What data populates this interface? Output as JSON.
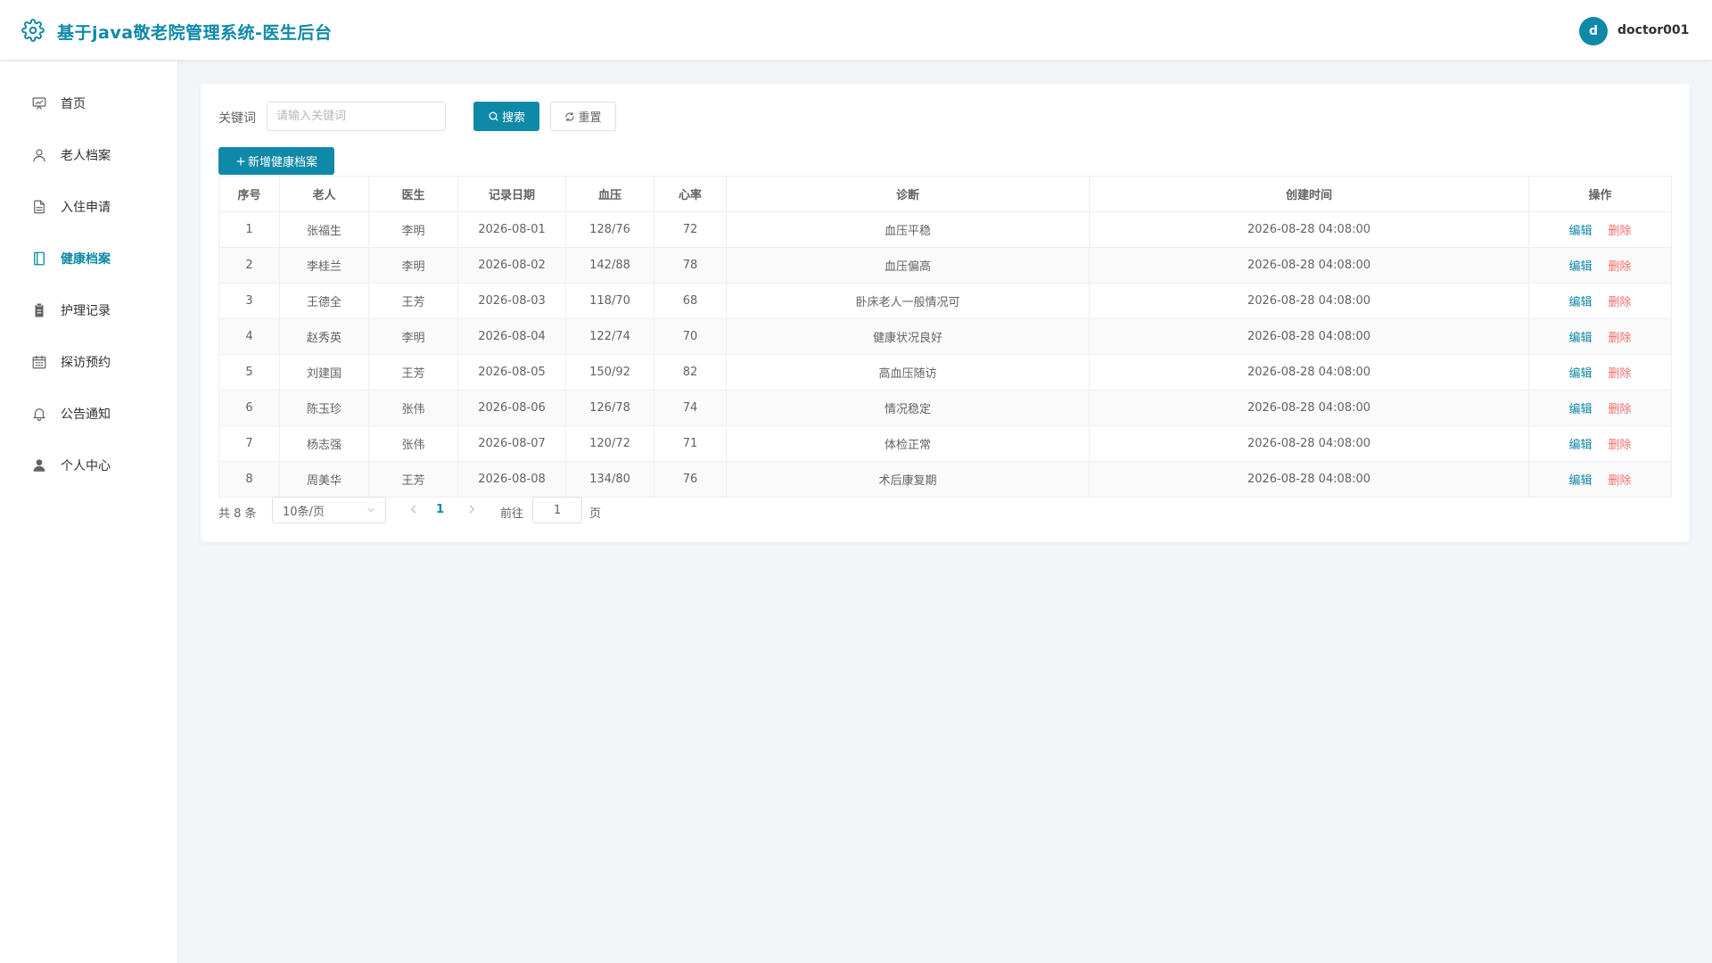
{
  "app": {
    "title": "基于java敬老院管理系统-医生后台",
    "user": {
      "avatar_letter": "d",
      "name": "doctor001"
    },
    "accent_color": "#0e89a8",
    "danger_color": "#f56c6c"
  },
  "sidebar": {
    "items": [
      {
        "label": "首页",
        "icon": "presentation-chart-icon",
        "active": false
      },
      {
        "label": "老人档案",
        "icon": "user-outline-icon",
        "active": false
      },
      {
        "label": "入住申请",
        "icon": "document-icon",
        "active": false
      },
      {
        "label": "健康档案",
        "icon": "notebook-icon",
        "active": true
      },
      {
        "label": "护理记录",
        "icon": "clipboard-icon",
        "active": false
      },
      {
        "label": "探访预约",
        "icon": "calendar-icon",
        "active": false
      },
      {
        "label": "公告通知",
        "icon": "bell-icon",
        "active": false
      },
      {
        "label": "个人中心",
        "icon": "user-filled-icon",
        "active": false
      }
    ]
  },
  "toolbar": {
    "keyword_label": "关键词",
    "keyword_placeholder": "请输入关键词",
    "keyword_value": "",
    "search_label": "搜索",
    "reset_label": "重置",
    "add_label": "新增健康档案"
  },
  "table": {
    "headers": [
      "序号",
      "老人",
      "医生",
      "记录日期",
      "血压",
      "心率",
      "诊断",
      "创建时间",
      "操作"
    ],
    "edit_label": "编辑",
    "delete_label": "删除",
    "rows": [
      {
        "no": "1",
        "elder": "张福生",
        "doctor": "李明",
        "date": "2026-08-01",
        "bp": "128/76",
        "hr": "72",
        "diagnosis": "血压平稳",
        "created": "2026-08-28 04:08:00"
      },
      {
        "no": "2",
        "elder": "李桂兰",
        "doctor": "李明",
        "date": "2026-08-02",
        "bp": "142/88",
        "hr": "78",
        "diagnosis": "血压偏高",
        "created": "2026-08-28 04:08:00"
      },
      {
        "no": "3",
        "elder": "王德全",
        "doctor": "王芳",
        "date": "2026-08-03",
        "bp": "118/70",
        "hr": "68",
        "diagnosis": "卧床老人一般情况可",
        "created": "2026-08-28 04:08:00"
      },
      {
        "no": "4",
        "elder": "赵秀英",
        "doctor": "李明",
        "date": "2026-08-04",
        "bp": "122/74",
        "hr": "70",
        "diagnosis": "健康状况良好",
        "created": "2026-08-28 04:08:00"
      },
      {
        "no": "5",
        "elder": "刘建国",
        "doctor": "王芳",
        "date": "2026-08-05",
        "bp": "150/92",
        "hr": "82",
        "diagnosis": "高血压随访",
        "created": "2026-08-28 04:08:00"
      },
      {
        "no": "6",
        "elder": "陈玉珍",
        "doctor": "张伟",
        "date": "2026-08-06",
        "bp": "126/78",
        "hr": "74",
        "diagnosis": "情况稳定",
        "created": "2026-08-28 04:08:00"
      },
      {
        "no": "7",
        "elder": "杨志强",
        "doctor": "张伟",
        "date": "2026-08-07",
        "bp": "120/72",
        "hr": "71",
        "diagnosis": "体检正常",
        "created": "2026-08-28 04:08:00"
      },
      {
        "no": "8",
        "elder": "周美华",
        "doctor": "王芳",
        "date": "2026-08-08",
        "bp": "134/80",
        "hr": "76",
        "diagnosis": "术后康复期",
        "created": "2026-08-28 04:08:00"
      }
    ]
  },
  "pagination": {
    "total_text": "共 8 条",
    "page_size": "10条/页",
    "current_page": "1",
    "goto_label": "前往",
    "goto_value": "1",
    "page_unit": "页"
  }
}
